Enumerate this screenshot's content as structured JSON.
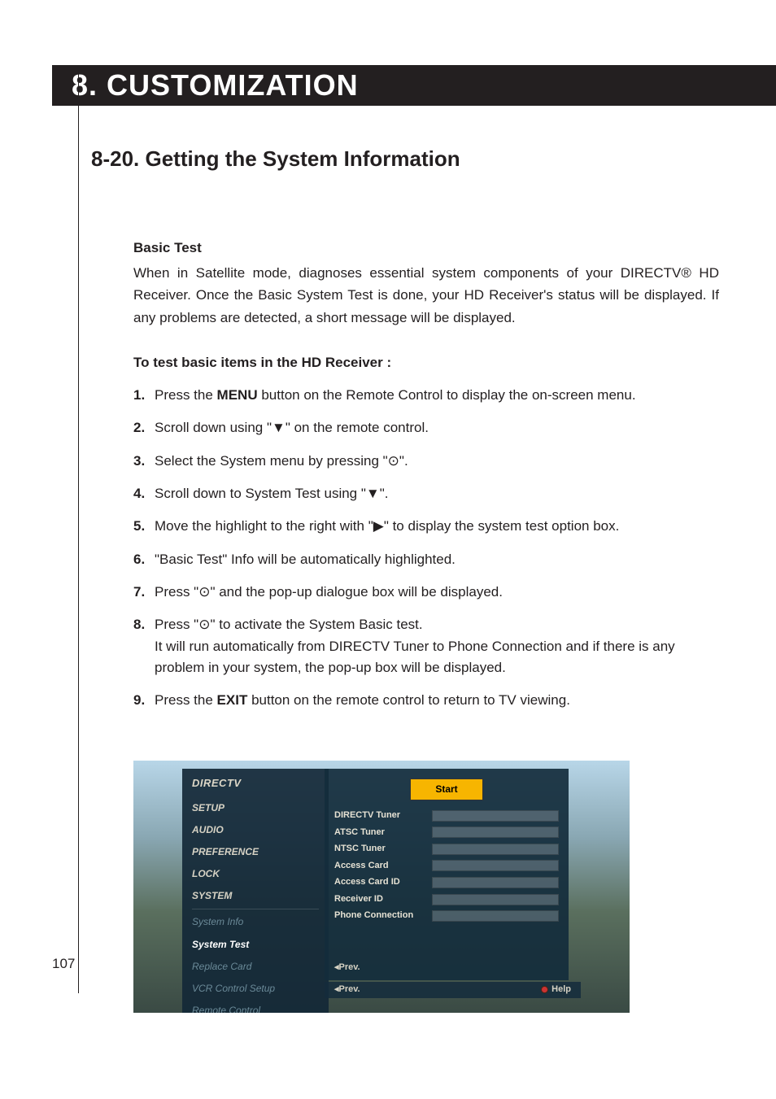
{
  "chapter": "8. CUSTOMIZATION",
  "section": "8-20. Getting the System Information",
  "page_number": "107",
  "basic_test": {
    "heading": "Basic Test",
    "paragraph": "When in Satellite mode, diagnoses essential system components of your DIRECTV® HD Receiver. Once the Basic System Test is done, your HD Receiver's status will be displayed. If any problems are detected, a short message will be displayed."
  },
  "instructions_heading": "To test basic items in the HD Receiver :",
  "symbols": {
    "down": "▼",
    "right": "▶",
    "select": "⊙"
  },
  "steps": {
    "s1": {
      "num": "1.",
      "pre": "Press the ",
      "bold": "MENU",
      "post": " button on the Remote Control to display the on-screen menu."
    },
    "s2": {
      "num": "2.",
      "pre": "Scroll down using \"",
      "sym": "▼",
      "post": "\" on the remote control."
    },
    "s3": {
      "num": "3.",
      "pre": "Select the System menu by pressing \"",
      "sym": "⊙",
      "post": "\"."
    },
    "s4": {
      "num": "4.",
      "pre": "Scroll down to System Test using \"",
      "sym": "▼",
      "post": "\"."
    },
    "s5": {
      "num": "5.",
      "pre": "Move the highlight to the right with \"",
      "sym": "▶",
      "post": "\" to display the system test option box."
    },
    "s6": {
      "num": "6.",
      "text": "\"Basic Test\" Info will be automatically highlighted."
    },
    "s7": {
      "num": "7.",
      "pre": "Press \"",
      "sym": "⊙",
      "post": "\" and the pop-up dialogue box will be displayed."
    },
    "s8": {
      "num": "8.",
      "pre": "Press \"",
      "sym": "⊙",
      "post": "\" to activate the System Basic test.",
      "line2": "It will run automatically from DIRECTV Tuner to Phone Connection and if there is any problem in your system, the pop-up box will be displayed."
    },
    "s9": {
      "num": "9.",
      "pre": "Press the ",
      "bold": "EXIT",
      "post": " button on the remote control to return to TV viewing."
    }
  },
  "mock": {
    "brand": "DIRECTV",
    "sidebar": {
      "setup": "SETUP",
      "audio": "AUDIO",
      "preference": "PREFERENCE",
      "lock": "LOCK",
      "system": "SYSTEM",
      "system_info": "System Info",
      "system_test": "System Test",
      "replace_card": "Replace Card",
      "vcr_setup": "VCR Control Setup",
      "remote": "Remote Control"
    },
    "start_label": "Start",
    "rows": {
      "r1": "DIRECTV Tuner",
      "r2": "ATSC Tuner",
      "r3": "NTSC Tuner",
      "r4": "Access Card",
      "r5": "Access Card ID",
      "r6": "Receiver ID",
      "r7": "Phone Connection"
    },
    "prev_inner": "◂Prev.",
    "prev_outer": "◂Prev.",
    "help": "Help"
  }
}
